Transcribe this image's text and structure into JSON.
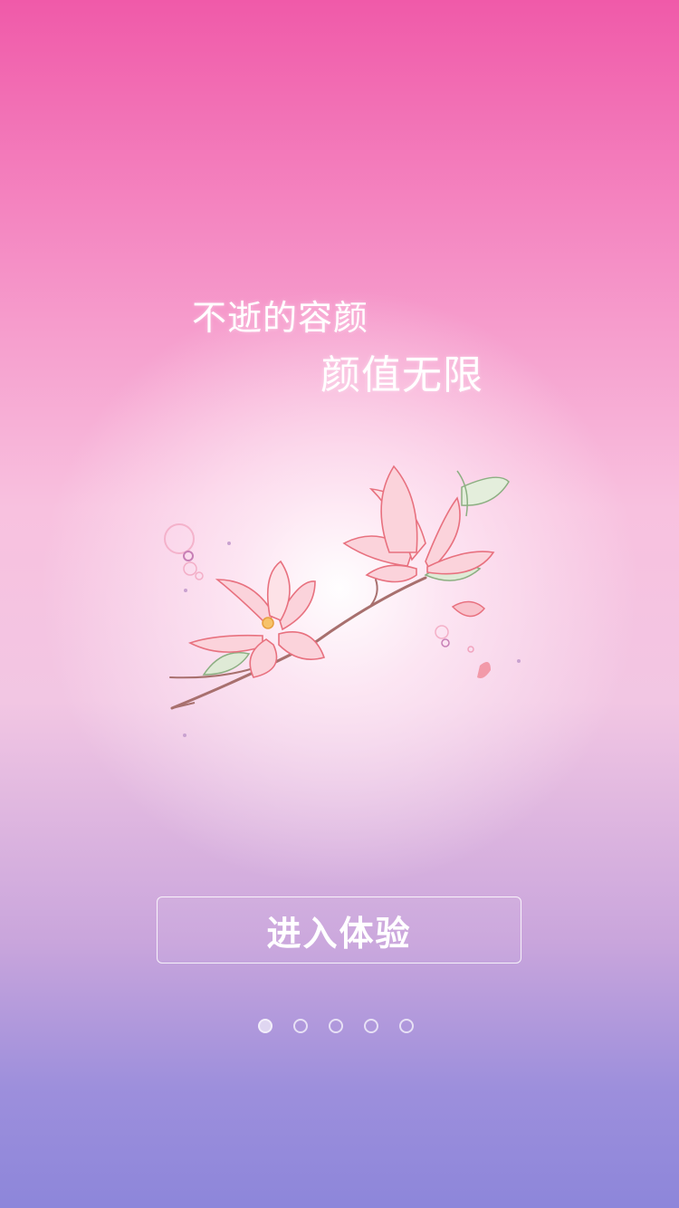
{
  "slogan": {
    "line1": "不逝的容颜",
    "line2": "颜值无限"
  },
  "illustration": {
    "icon": "magnolia-branch-illustration",
    "petal_color": "#f7b8c4",
    "outline_color": "#e8717f",
    "leaf_color": "#9bbf8f"
  },
  "enter_button": {
    "label": "进入体验"
  },
  "pagination": {
    "total_pages": 5,
    "current_page": 1
  },
  "colors": {
    "top": "#f05aa9",
    "bottom": "#8d86da"
  }
}
